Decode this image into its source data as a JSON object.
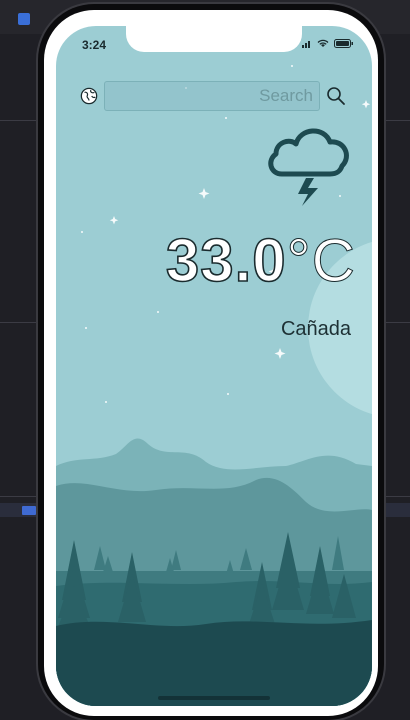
{
  "status": {
    "time": "3:24"
  },
  "search": {
    "placeholder": "Search"
  },
  "weather": {
    "temperature": "33.0",
    "unit": "°C",
    "city": "Cañada"
  },
  "icons": {
    "location": "globe-icon",
    "search": "search-icon",
    "condition": "thunderstorm-cloud-icon"
  },
  "colors": {
    "sky": "#9ccdd3",
    "mountains_far": "#7bb3b8",
    "mountains_mid": "#5a9499",
    "forest": "#2f6b70",
    "foreground": "#1d4a50",
    "icon": "#1d4a50"
  }
}
